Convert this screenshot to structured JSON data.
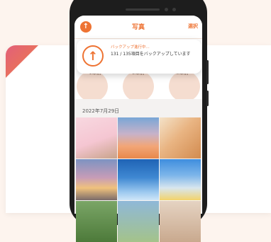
{
  "header": {
    "title": "写真",
    "select_label": "選択"
  },
  "backup_banner": {
    "status": "バックアップ進行中...",
    "message": "131 / 135項目をバックアップしています"
  },
  "year_groups": [
    {
      "label": "1年前"
    },
    {
      "label": "2年前"
    },
    {
      "label": "3年前"
    }
  ],
  "section": {
    "date": "2022年7月29日"
  },
  "photos": [
    {
      "subject": "cat-with-party-hat"
    },
    {
      "subject": "sunset-sky"
    },
    {
      "subject": "kitten"
    },
    {
      "subject": "person-at-sunrise"
    },
    {
      "subject": "blue-sky"
    },
    {
      "subject": "clouds-sky"
    },
    {
      "subject": "greenery"
    },
    {
      "subject": "landscape"
    },
    {
      "subject": "cat"
    }
  ],
  "colors": {
    "accent": "#ee7333",
    "background": "#fdf4ee"
  }
}
